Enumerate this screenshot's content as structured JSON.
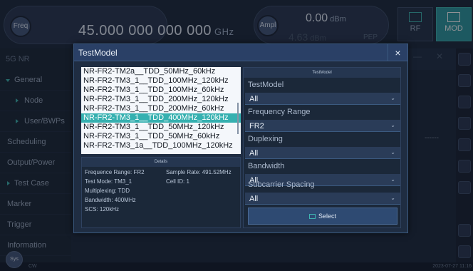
{
  "top": {
    "freq_button": "Freq",
    "freq_value": "45.000 000 000 000",
    "freq_unit": "GHz",
    "ampl_button": "Ampl",
    "ampl_value": "0.00",
    "ampl_unit": "dBm",
    "ampl_value2": "4.63",
    "ampl_unit2": "dBm",
    "pep_label": "PEP",
    "mode_rf": "RF",
    "mode_mod": "MOD"
  },
  "sidebar": {
    "title": "5G NR",
    "items": [
      {
        "label": "General"
      },
      {
        "label": "Node"
      },
      {
        "label": "User/BWPs"
      },
      {
        "label": "Scheduling"
      },
      {
        "label": "Output/Power"
      },
      {
        "label": "Test Case"
      },
      {
        "label": "Marker"
      },
      {
        "label": "Trigger"
      },
      {
        "label": "Information"
      }
    ]
  },
  "background": {
    "dash_value": "------"
  },
  "status": {
    "sys_label": "Sys",
    "cw_label": "CW",
    "clock": "2023-07-27 11:16"
  },
  "dialog": {
    "title": "TestModel",
    "close": "×",
    "list": [
      "NR-FR2-TM2a__TDD_50MHz_60kHz",
      "NR-FR2-TM3_1__TDD_100MHz_120kHz",
      "NR-FR2-TM3_1__TDD_100MHz_60kHz",
      "NR-FR2-TM3_1__TDD_200MHz_120kHz",
      "NR-FR2-TM3_1__TDD_200MHz_60kHz",
      "NR-FR2-TM3_1__TDD_400MHz_120kHz",
      "NR-FR2-TM3_1__TDD_50MHz_120kHz",
      "NR-FR2-TM3_1__TDD_50MHz_60kHz",
      "NR-FR2-TM3_1a__TDD_100MHz_120kHz"
    ],
    "selected_index": 5,
    "details": {
      "header": "Details",
      "frequence_range": "Frequence Range: FR2",
      "sample_rate": "Sample Rate: 491.52MHz",
      "test_mode": "Test Mode: TM3_1",
      "cell_id": "Cell ID: 1",
      "multiplexing": "Multiplexing: TDD",
      "bandwidth": "Bandwidth: 400MHz",
      "scs": "SCS: 120kHz"
    },
    "panel": {
      "header": "TestModel",
      "fields": [
        {
          "label": "TestModel",
          "value": "All"
        },
        {
          "label": "Frequency Range",
          "value": "FR2"
        },
        {
          "label": "Duplexing",
          "value": "All"
        },
        {
          "label": "Bandwidth",
          "value": "All"
        },
        {
          "label": "Subcarrier Spacing",
          "value": "All"
        }
      ],
      "select_label": "Select"
    }
  },
  "colors": {
    "accent": "#35b0b0",
    "dialog_header": "#2a4066",
    "background": "#1a2636"
  }
}
